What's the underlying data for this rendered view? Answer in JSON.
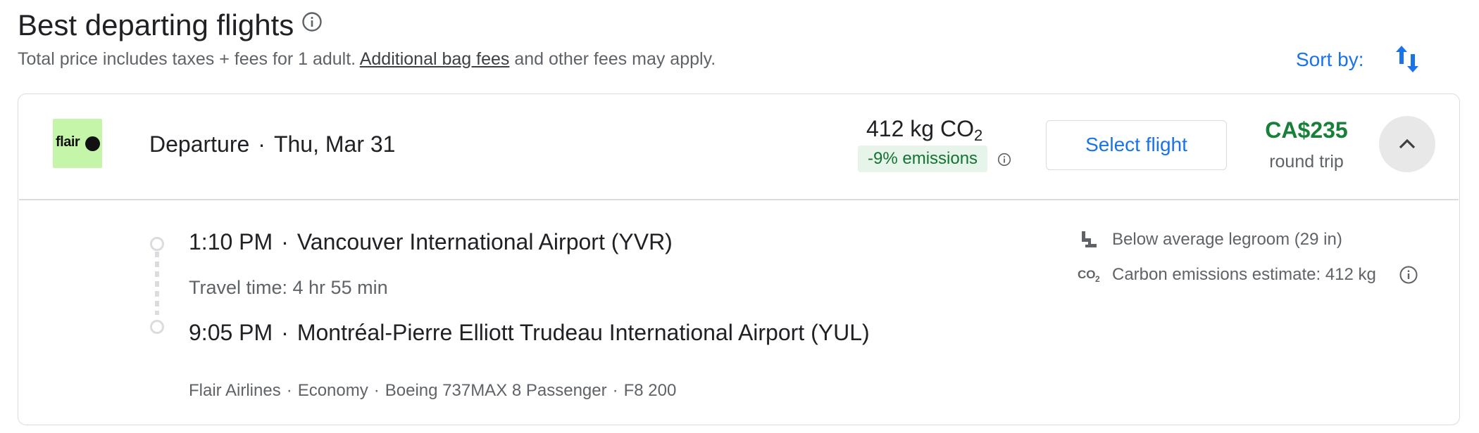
{
  "header": {
    "title": "Best departing flights",
    "subtitle_prefix": "Total price includes taxes + fees for 1 adult.",
    "subtitle_link": "Additional bag fees",
    "subtitle_suffix": "and other fees may apply.",
    "sort_label": "Sort by:",
    "icons": {
      "title_info": "info-icon",
      "sort": "sort-arrows-icon"
    }
  },
  "flight": {
    "airline_logo_text": "flair",
    "departure_label": "Departure",
    "separator": "·",
    "date": "Thu, Mar 31",
    "co2_value": "412 kg CO",
    "co2_sub": "2",
    "emissions_badge": "-9% emissions",
    "select_button": "Select flight",
    "price": "CA$235",
    "price_note": "round trip",
    "colors": {
      "price": "#188038",
      "accent": "#1a73e8",
      "badge_bg": "#e6f4ea",
      "badge_text": "#137333",
      "logo_bg": "#c5f5a8"
    }
  },
  "itinerary": {
    "departure_time": "1:10 PM",
    "departure_airport": "Vancouver International Airport (YVR)",
    "travel_time": "Travel time: 4 hr 55 min",
    "arrival_time": "9:05 PM",
    "arrival_airport": "Montréal-Pierre Elliott Trudeau International Airport (YUL)",
    "details": [
      "Flair Airlines",
      "Economy",
      "Boeing 737MAX 8 Passenger",
      "F8 200"
    ]
  },
  "amenities": {
    "legroom": "Below average legroom (29 in)",
    "emissions": "Carbon emissions estimate: 412 kg",
    "icons": {
      "legroom": "seat-icon",
      "emissions": "co2-icon"
    }
  }
}
